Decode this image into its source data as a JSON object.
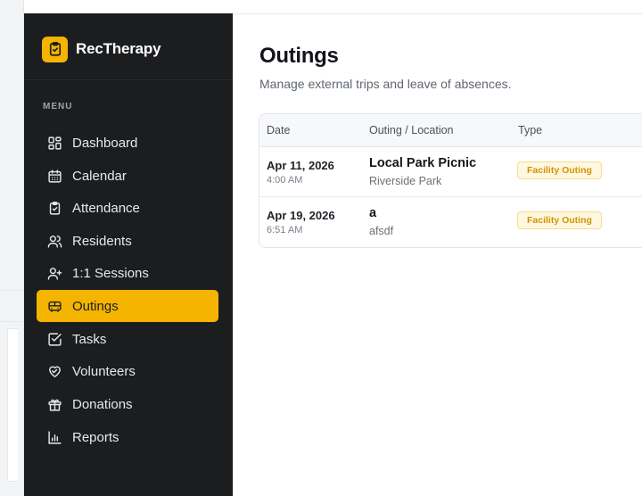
{
  "app": {
    "name": "RecTherapy",
    "brand_color": "#f4b400",
    "sidebar_bg": "#1c1d1f"
  },
  "sidebar": {
    "menu_heading": "MENU",
    "active_item": "Outings",
    "items": [
      {
        "label": "Dashboard",
        "icon": "dashboard-icon"
      },
      {
        "label": "Calendar",
        "icon": "calendar-icon"
      },
      {
        "label": "Attendance",
        "icon": "clipboard-check-icon"
      },
      {
        "label": "Residents",
        "icon": "users-icon"
      },
      {
        "label": "1:1 Sessions",
        "icon": "user-plus-icon"
      },
      {
        "label": "Outings",
        "icon": "bus-icon"
      },
      {
        "label": "Tasks",
        "icon": "checkbox-icon"
      },
      {
        "label": "Volunteers",
        "icon": "heart-handshake-icon"
      },
      {
        "label": "Donations",
        "icon": "gift-icon"
      },
      {
        "label": "Reports",
        "icon": "bar-chart-icon"
      }
    ]
  },
  "page": {
    "title": "Outings",
    "subtitle": "Manage external trips and leave of absences."
  },
  "table": {
    "columns": [
      "Date",
      "Outing / Location",
      "Type"
    ],
    "rows": [
      {
        "date": "Apr 11, 2026",
        "time": "4:00 AM",
        "name": "Local Park Picnic",
        "location": "Riverside Park",
        "type": "Facility Outing"
      },
      {
        "date": "Apr 19, 2026",
        "time": "6:51 AM",
        "name": "a",
        "location": "afsdf",
        "type": "Facility Outing"
      }
    ]
  }
}
